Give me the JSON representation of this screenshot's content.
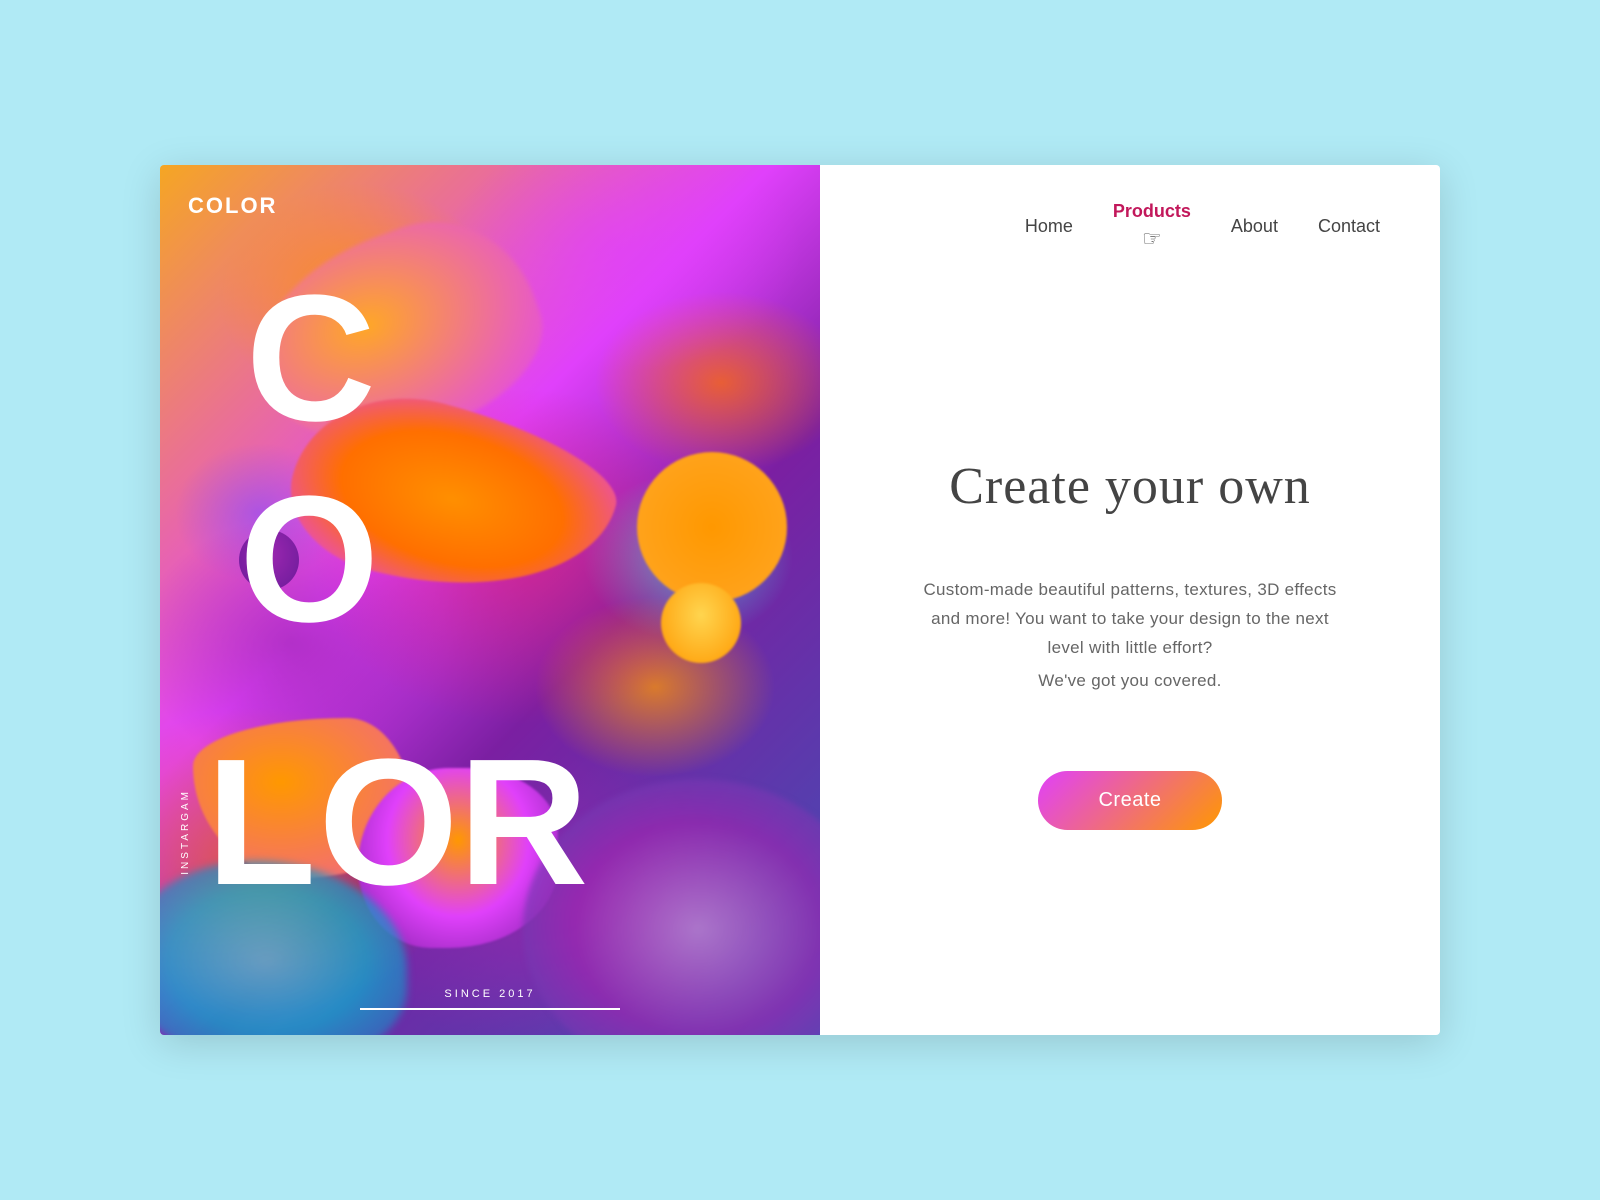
{
  "brand": {
    "logo": "COLOR",
    "tagline_side": "INSTARGAM",
    "since": "SINCE 2017"
  },
  "big_letters": {
    "c": "C",
    "o": "O",
    "l": "L",
    "or": "OR"
  },
  "nav": {
    "items": [
      {
        "label": "Home",
        "active": false
      },
      {
        "label": "Products",
        "active": true
      },
      {
        "label": "About",
        "active": false
      },
      {
        "label": "Contact",
        "active": false
      }
    ]
  },
  "hero": {
    "headline": "Create your own",
    "description": "Custom-made beautiful patterns, textures,\n3D effects and more! You want to take your\ndesign to the next level with little effort?",
    "tagline": "We've got you covered.",
    "cta_label": "Create"
  }
}
